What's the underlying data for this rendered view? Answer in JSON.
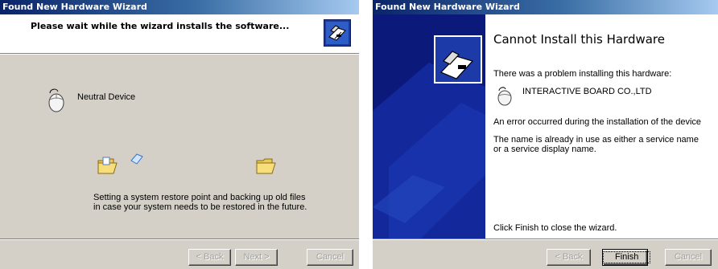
{
  "left_window": {
    "title": "Found New Hardware Wizard",
    "header": "Please wait while the wizard installs the software...",
    "device_name": "Neutral Device",
    "status_text": "Setting a system restore point and backing up old files in case your system needs to be restored in the future.",
    "buttons": {
      "back": "< Back",
      "next": "Next >",
      "cancel": "Cancel"
    }
  },
  "right_window": {
    "title": "Found New Hardware Wizard",
    "heading": "Cannot Install this Hardware",
    "problem_text": "There was a problem installing this hardware:",
    "device_name": "INTERACTIVE BOARD  CO.,LTD",
    "error_text": "An error occurred during the installation of the device",
    "detail_text": "The name is already in use as either a service name or a service display name.",
    "finish_hint": "Click Finish to close the wizard.",
    "buttons": {
      "back": "< Back",
      "finish": "Finish",
      "cancel": "Cancel"
    }
  },
  "colors": {
    "titlebar": "#0a246a",
    "sidebar": "#0b1a7a",
    "dialog_face": "#d4d0c8"
  },
  "icons": [
    "hardware-wizard-icon",
    "mouse-icon",
    "open-folder-icon",
    "flying-document-icon"
  ]
}
